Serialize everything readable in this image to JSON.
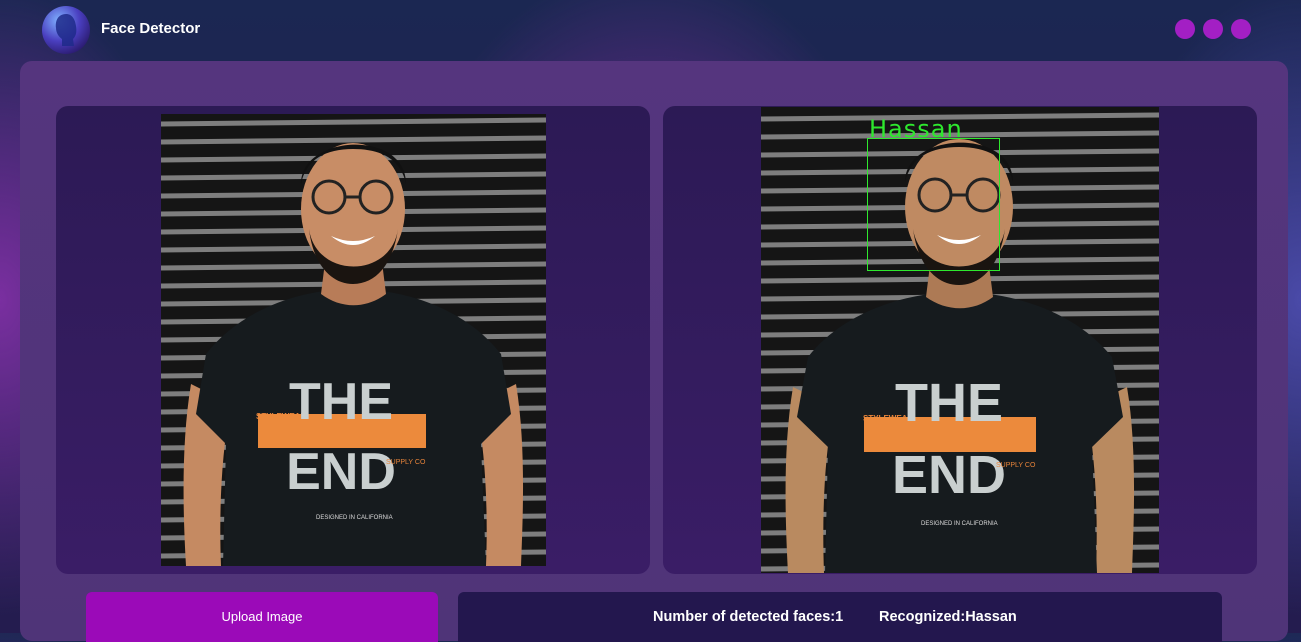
{
  "header": {
    "title": "Face Detector",
    "logo_icon": "face-silhouette-icon",
    "window_dots": [
      "dot-1",
      "dot-2",
      "dot-3"
    ],
    "dot_color": "#a31fc4"
  },
  "original_image": {
    "alt": "Uploaded portrait",
    "shirt_text": {
      "brand": "STYLEWEAR",
      "line1": "THE",
      "line2": "END",
      "sub": "SUPPLY CO",
      "footer": "DESIGNED IN CALIFORNIA"
    }
  },
  "processed_image": {
    "face_label": "Hassan",
    "box_color": "#2ee82e",
    "shirt_text": {
      "brand": "STYLEWEAR",
      "line1": "THE",
      "line2": "END",
      "sub": "SUPPLY CO",
      "footer": "DESIGNED IN CALIFORNIA"
    }
  },
  "controls": {
    "upload_label": "Upload Image"
  },
  "results": {
    "faces_text": "Number of detected faces:1",
    "recognized_text": "Recognized:Hassan"
  }
}
